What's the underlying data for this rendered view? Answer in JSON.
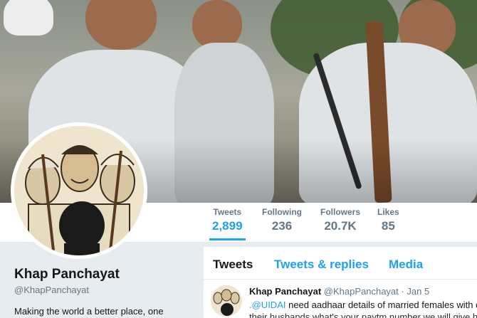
{
  "profile": {
    "name": "Khap Panchayat",
    "handle": "@KhapPanchayat",
    "bio": "Making the world a better place, one"
  },
  "stats": [
    {
      "label": "Tweets",
      "value": "2,899",
      "active": true
    },
    {
      "label": "Following",
      "value": "236",
      "active": false
    },
    {
      "label": "Followers",
      "value": "20.7K",
      "active": false
    },
    {
      "label": "Likes",
      "value": "85",
      "active": false
    }
  ],
  "tabs": [
    {
      "label": "Tweets",
      "active": true
    },
    {
      "label": "Tweets & replies",
      "active": false
    },
    {
      "label": "Media",
      "active": false
    }
  ],
  "tweet": {
    "name": "Khap Panchayat",
    "handle": "@KhapPanchayat",
    "separator": "·",
    "date": "Jan 5",
    "mention": ".@UIDAI",
    "text_line1": " need aadhaar details of married females with d",
    "text_line2": "their husbands what's your paytm number we will give h"
  },
  "colors": {
    "accent": "#1da1f2",
    "text_primary": "#14171a",
    "text_secondary": "#657786",
    "page_bg": "#e6ecf0"
  }
}
